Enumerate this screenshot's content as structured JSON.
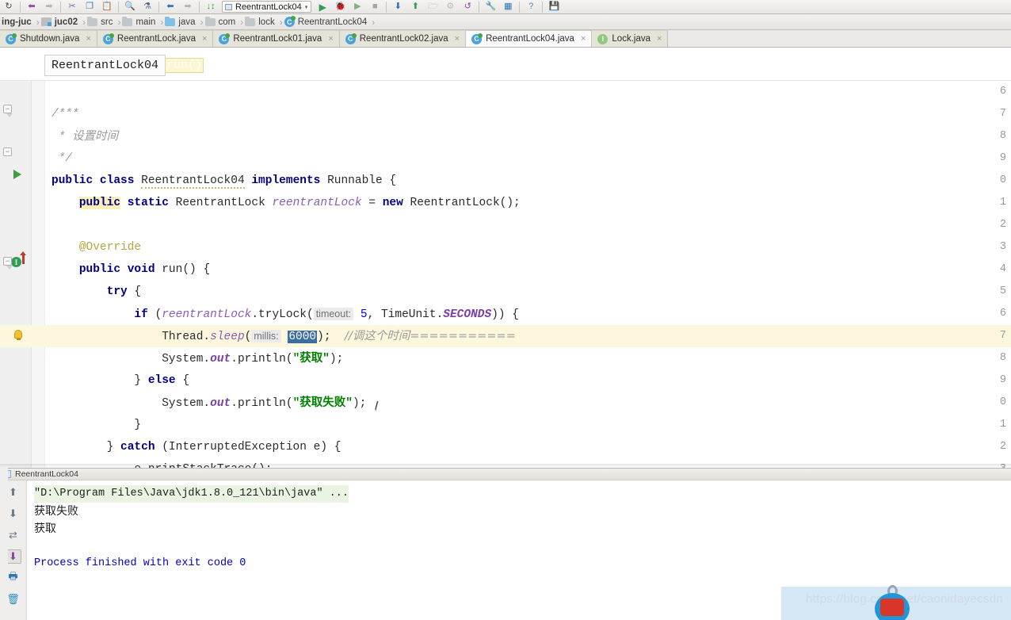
{
  "toolbar": {
    "icons": [
      "sync-icon",
      "undo-icon",
      "redo-icon",
      "cut-icon",
      "copy-icon",
      "paste-icon",
      "find-icon",
      "replace-icon",
      "back-icon",
      "forward-icon",
      "jump-to-source-icon"
    ],
    "run_config": {
      "name": "ReentrantLock04",
      "caret": "▾"
    },
    "run_label": "▶",
    "debug_label": "🐞",
    "coverage_label": "▶⫽",
    "stop_label": "■",
    "right_icons": [
      "step-down-icon",
      "step-up-icon",
      "open-icon",
      "settings-icon",
      "revert-icon",
      "wrench-icon",
      "grid-icon",
      "help-icon",
      "save-icon"
    ]
  },
  "breadcrumb": {
    "separator": "›",
    "items": [
      {
        "label": "ing-juc",
        "icon": "module-icon",
        "bold": true
      },
      {
        "label": "juc02",
        "icon": "module-icon",
        "bold": true
      },
      {
        "label": "src",
        "icon": "folder-icon",
        "bold": false
      },
      {
        "label": "main",
        "icon": "folder-icon",
        "bold": false
      },
      {
        "label": "java",
        "icon": "source-folder-icon",
        "bold": false
      },
      {
        "label": "com",
        "icon": "package-icon",
        "bold": false
      },
      {
        "label": "lock",
        "icon": "package-icon",
        "bold": false
      },
      {
        "label": "ReentrantLock04",
        "icon": "class-icon",
        "bold": false
      }
    ]
  },
  "editor_tabs": [
    {
      "label": "Shutdown.java",
      "icon": "class-icon",
      "active": false,
      "close": "×"
    },
    {
      "label": "ReentrantLock.java",
      "icon": "class-icon",
      "active": false,
      "close": "×"
    },
    {
      "label": "ReentrantLock01.java",
      "icon": "class-icon",
      "active": false,
      "close": "×"
    },
    {
      "label": "ReentrantLock02.java",
      "icon": "class-icon",
      "active": false,
      "close": "×"
    },
    {
      "label": "ReentrantLock04.java",
      "icon": "class-icon",
      "active": true,
      "close": "×"
    },
    {
      "label": "Lock.java",
      "icon": "interface-icon",
      "active": false,
      "close": "×"
    }
  ],
  "structure_bar": {
    "class_chip": "ReentrantLock04",
    "method_chip": "run()"
  },
  "editor": {
    "line_numbers": [
      "6",
      "7",
      "8",
      "9",
      "0",
      "1",
      "2",
      "3",
      "4",
      "5",
      "6",
      "7",
      "8",
      "9",
      "0",
      "1",
      "2",
      "3"
    ],
    "code_lines": [
      "",
      "/***",
      " * 设置时间",
      " */",
      "public class ReentrantLock04 implements Runnable {",
      "    public static ReentrantLock reentrantLock = new ReentrantLock();",
      "",
      "    @Override",
      "    public void run() {",
      "        try {",
      "            if (reentrantLock.tryLock( timeout: 5, TimeUnit.SECONDS)) {",
      "                Thread.sleep( millis: 6000);  //调这个时间===========",
      "                System.out.println(\"获取\");",
      "            } else {",
      "                System.out.println(\"获取失败\");",
      "            }",
      "        } catch (InterruptedException e) {",
      "            e.printStackTrace();"
    ],
    "selected_text": "6000",
    "param_hints": [
      "timeout:",
      "millis:"
    ],
    "comment_inline": "//调这个时间===========",
    "gutter_markers": {
      "run_class_line": "run-class-icon",
      "override_line": "override-method-icon",
      "intention_bulb": "lightbulb-icon"
    }
  },
  "run_panel": {
    "tab_title": "ReentrantLock04",
    "side_icons": [
      "scroll-up-icon",
      "scroll-down-icon",
      "soft-wrap-icon",
      "scroll-to-end-icon",
      "print-icon",
      "trash-icon"
    ],
    "console_lines": [
      {
        "text": "\"D:\\Program Files\\Java\\jdk1.8.0_121\\bin\\java\" ...",
        "style": "cmd"
      },
      {
        "text": "获取失败",
        "style": "cn"
      },
      {
        "text": "获取",
        "style": "cn"
      },
      {
        "text": "",
        "style": "plain"
      },
      {
        "text": "Process finished with exit code 0",
        "style": "exit"
      }
    ]
  },
  "watermark": {
    "url": "https://blog.csdn.net/caonidayecsdn"
  },
  "colors": {
    "keyword": "#000080",
    "string": "#008000",
    "number": "#0000ee",
    "comment": "#9a9a9a",
    "field": "#8b5cb5",
    "selection": "#3a6ea5",
    "line_highlight": "#fdf8dd",
    "accent_green": "#3c9f40"
  }
}
